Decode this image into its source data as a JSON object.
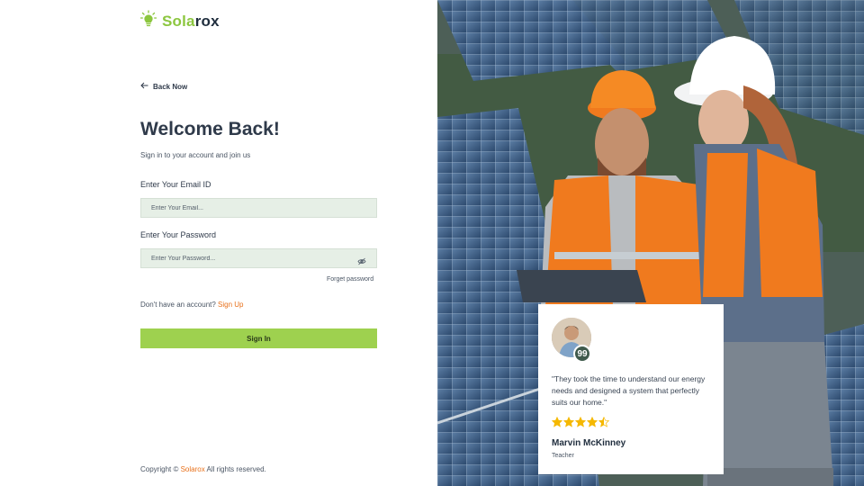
{
  "brand": {
    "name_part1": "Sola",
    "name_part2": "rox",
    "accent_color": "#8cc63f",
    "icon": "lightbulb-icon"
  },
  "nav": {
    "back_label": "Back Now",
    "back_icon": "arrow-left-icon"
  },
  "form": {
    "title": "Welcome Back!",
    "subtitle": "Sign in to your account and join us",
    "email_label": "Enter Your Email ID",
    "email_placeholder": "Enter Your Email...",
    "password_label": "Enter Your Password",
    "password_placeholder": "Enter Your Password...",
    "password_toggle_icon": "eye-off-icon",
    "forgot_label": "Forget password",
    "no_account_text": "Don't have an account?",
    "signup_label": "Sign Up",
    "signin_label": "Sign In",
    "signin_color": "#9ed14f",
    "link_color": "#e8701a"
  },
  "footer": {
    "prefix": "Copyright ©",
    "brand": "Solarox",
    "suffix": "All rights reserved."
  },
  "testimonial": {
    "badge_text": "99",
    "quote": "\"They took the time to understand our energy needs and designed a system that perfectly suits our home.\"",
    "rating": 4.5,
    "rating_max": 5,
    "star_color": "#f5b800",
    "name": "Marvin McKinney",
    "role": "Teacher"
  }
}
